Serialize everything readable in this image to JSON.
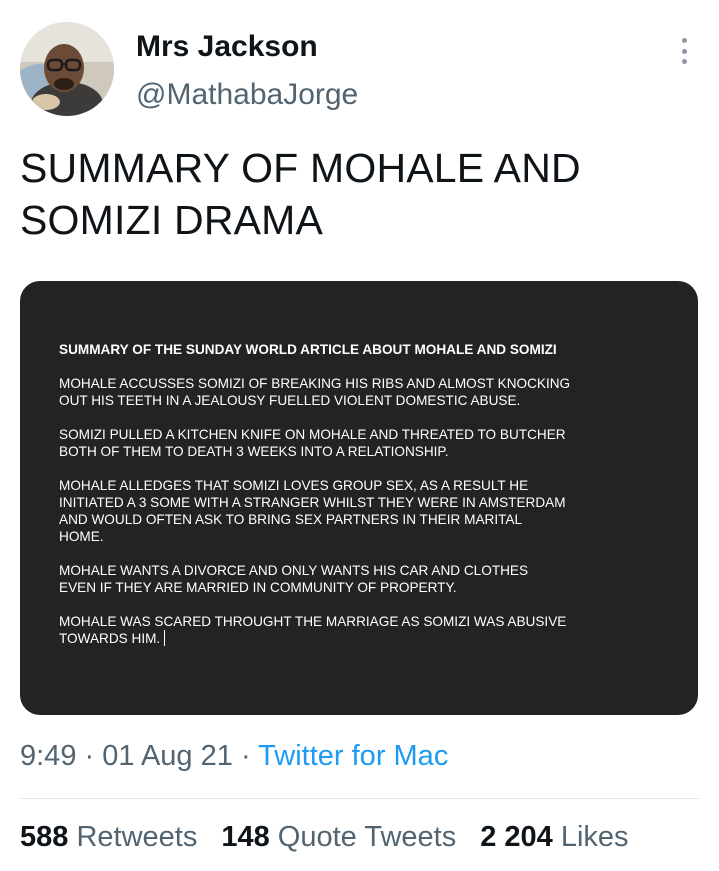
{
  "author": {
    "display_name": "Mrs Jackson",
    "handle": "@MathabaJorge"
  },
  "tweet": {
    "text_line_1": "SUMMARY OF MOHALE AND",
    "text_line_2": "SOMIZI DRAMA"
  },
  "media": {
    "title": "SUMMARY OF THE SUNDAY WORLD ARTICLE ABOUT MOHALE AND SOMIZI",
    "paragraphs": [
      [
        "MOHALE ACCUSSES SOMIZI OF BREAKING HIS RIBS AND ALMOST KNOCKING",
        "OUT HIS TEETH IN A JEALOUSY FUELLED VIOLENT DOMESTIC ABUSE."
      ],
      [
        "SOMIZI PULLED A KITCHEN KNIFE ON MOHALE AND THREATED TO BUTCHER",
        "BOTH OF THEM TO DEATH 3 WEEKS INTO A RELATIONSHIP."
      ],
      [
        "MOHALE ALLEDGES THAT SOMIZI LOVES GROUP SEX, AS A RESULT HE",
        "INITIATED A 3 SOME WITH A STRANGER WHILST THEY WERE IN AMSTERDAM",
        "AND WOULD OFTEN ASK TO BRING SEX PARTNERS IN THEIR MARITAL",
        "HOME."
      ],
      [
        "MOHALE WANTS A DIVORCE AND ONLY WANTS HIS CAR AND CLOTHES",
        "EVEN IF THEY ARE MARRIED IN COMMUNITY OF PROPERTY."
      ],
      [
        "MOHALE WAS SCARED THROUGHT THE MARRIAGE AS SOMIZI WAS ABUSIVE",
        "TOWARDS HIM."
      ]
    ]
  },
  "meta": {
    "time": "9:49",
    "separator": "·",
    "date": "01 Aug 21",
    "source": "Twitter for Mac"
  },
  "stats": {
    "retweets_count": "588",
    "retweets_label": "Retweets",
    "quotes_count": "148",
    "quotes_label": "Quote Tweets",
    "likes_count": "2 204",
    "likes_label": "Likes"
  },
  "icons": {
    "more": "more-vertical-icon"
  },
  "colors": {
    "link": "#1d9bf0",
    "secondary_text": "#536471",
    "media_bg": "#232323"
  }
}
